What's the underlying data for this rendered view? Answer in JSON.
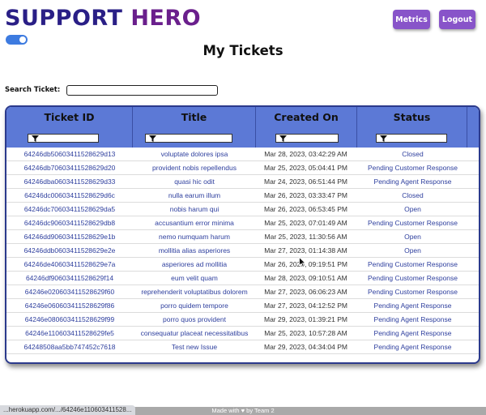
{
  "header": {
    "brand_word1": "SUPPORT",
    "brand_word2": "HERO",
    "metrics_label": "Metrics",
    "logout_label": "Logout",
    "theme_toggle_on": true
  },
  "page": {
    "title": "My Tickets"
  },
  "search": {
    "label": "Search Ticket:",
    "value": ""
  },
  "table": {
    "columns": [
      "Ticket ID",
      "Title",
      "Created On",
      "Status"
    ],
    "rows": [
      {
        "id": "64246db50603411528629d13",
        "title": "voluptate dolores ipsa",
        "created": "Mar 28, 2023, 03:42:29 AM",
        "status": "Closed"
      },
      {
        "id": "64246db70603411528629d20",
        "title": "provident nobis repellendus",
        "created": "Mar 25, 2023, 05:04:41 PM",
        "status": "Pending Customer Response"
      },
      {
        "id": "64246dba0603411528629d33",
        "title": "quasi hic odit",
        "created": "Mar 24, 2023, 06:51:44 PM",
        "status": "Pending Agent Response"
      },
      {
        "id": "64246dc00603411528629d6c",
        "title": "nulla earum illum",
        "created": "Mar 26, 2023, 03:33:47 PM",
        "status": "Closed"
      },
      {
        "id": "64246dc70603411528629da5",
        "title": "nobis harum qui",
        "created": "Mar 26, 2023, 06:53:45 PM",
        "status": "Open"
      },
      {
        "id": "64246dc90603411528629db8",
        "title": "accusantium error minima",
        "created": "Mar 25, 2023, 07:01:49 AM",
        "status": "Pending Customer Response"
      },
      {
        "id": "64246dd90603411528629e1b",
        "title": "nemo numquam harum",
        "created": "Mar 25, 2023, 11:30:56 AM",
        "status": "Open"
      },
      {
        "id": "64246ddb0603411528629e2e",
        "title": "mollitia alias asperiores",
        "created": "Mar 27, 2023, 01:14:38 AM",
        "status": "Open"
      },
      {
        "id": "64246de40603411528629e7a",
        "title": "asperiores ad mollitia",
        "created": "Mar 26, 2023, 09:19:51 PM",
        "status": "Pending Customer Response"
      },
      {
        "id": "64246df90603411528629f14",
        "title": "eum velit quam",
        "created": "Mar 28, 2023, 09:10:51 AM",
        "status": "Pending Customer Response"
      },
      {
        "id": "64246e020603411528629f60",
        "title": "reprehenderit voluptatibus dolorem",
        "created": "Mar 27, 2023, 06:06:23 AM",
        "status": "Pending Customer Response"
      },
      {
        "id": "64246e060603411528629f86",
        "title": "porro quidem tempore",
        "created": "Mar 27, 2023, 04:12:52 PM",
        "status": "Pending Agent Response"
      },
      {
        "id": "64246e080603411528629f99",
        "title": "porro quos provident",
        "created": "Mar 29, 2023, 01:39:21 PM",
        "status": "Pending Agent Response"
      },
      {
        "id": "64246e110603411528629fe5",
        "title": "consequatur placeat necessitatibus",
        "created": "Mar 25, 2023, 10:57:28 AM",
        "status": "Pending Agent Response"
      },
      {
        "id": "64248508aa5bb747452c7618",
        "title": "Test new Issue",
        "created": "Mar 29, 2023, 04:34:04 PM",
        "status": "Pending Agent Response"
      }
    ]
  },
  "footer": {
    "text": "Made with ♥ by Team 2",
    "status_url": "...herokuapp.com/.../64246e110603411528..."
  },
  "colors": {
    "brand_primary": "#2a1f86",
    "brand_secondary": "#6a1f8c",
    "button": "#8854c9",
    "table_header": "#5c79d6",
    "link_text": "#2e3f9e"
  },
  "icons": [
    "filter-icon",
    "toggle-switch",
    "mouse-cursor-icon"
  ]
}
